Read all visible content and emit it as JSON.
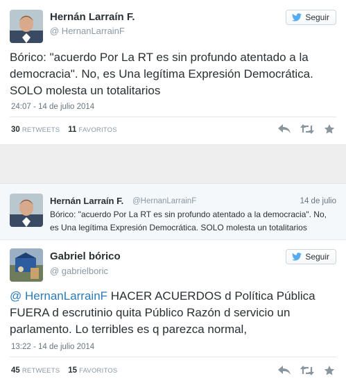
{
  "tweet1": {
    "name": "Hernán Larraín F.",
    "handle": "@ HernanLarrainF",
    "follow_label": "Seguir",
    "text": "Bórico: \"acuerdo Por La RT es sin profundo atentado a la democracia\". No, es Una legítima Expresión Democrática. SOLO molesta un totalitarios",
    "timestamp": "24:07 - 14 de julio 2014",
    "retweets_count": "30",
    "retweets_label": "RETWEETS",
    "favorites_count": "11",
    "favorites_label": "FAVORITOS"
  },
  "quoted": {
    "name": "Hernán Larraín F.",
    "handle": "@HernanLarrainF",
    "date": "14 de julio",
    "text": "Bórico: \"acuerdo Por La RT es sin profundo atentado a la democracia\". No, es Una legítima Expresión Democrática. SOLO molesta un totalitarios"
  },
  "tweet2": {
    "name": "Gabriel bórico",
    "handle": "@ gabrielboric",
    "follow_label": "Seguir",
    "mention": "@ HernanLarrainF",
    "text": "HACER ACUERDOS d Política Pública FUERA d escrutinio quita Público Razón d servicio un parlamento. Lo terribles es q parezca normal,",
    "timestamp": "13:22 - 14 de julio 2014",
    "retweets_count": "45",
    "retweets_label": "RETWEETS",
    "favorites_count": "15",
    "favorites_label": "FAVORITOS"
  },
  "icons": {
    "bird": "twitter-bird-icon",
    "reply": "reply-icon",
    "retweet": "retweet-icon",
    "favorite": "star-icon"
  },
  "colors": {
    "twitter_blue": "#55acee",
    "mention_blue": "#2b7bb9",
    "muted": "#8899a6",
    "action_gray": "#aab8c2"
  }
}
